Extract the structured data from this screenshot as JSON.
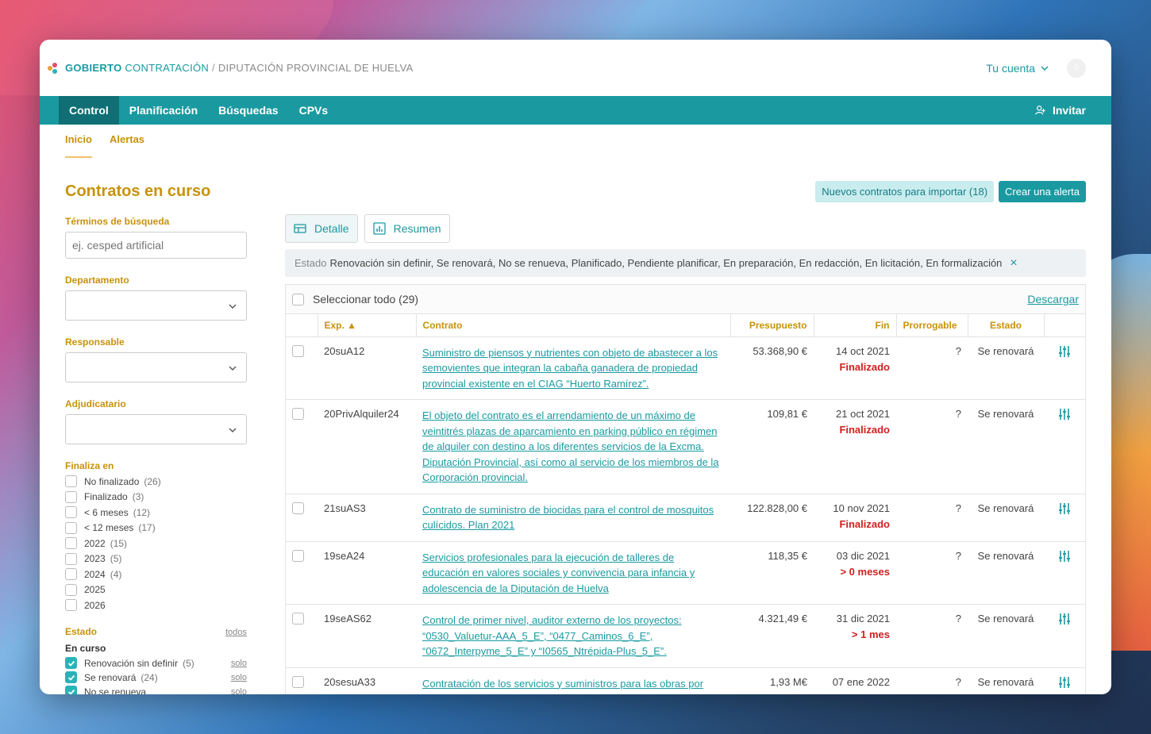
{
  "header": {
    "brand_bold": "GOBIERTO",
    "brand_rest": " CONTRATACIÓN",
    "separator": " / ",
    "organization": "DIPUTACIÓN PROVINCIAL DE HUELVA",
    "account_label": "Tu cuenta",
    "avatar_count": "0"
  },
  "nav": {
    "tabs": [
      "Control",
      "Planificación",
      "Búsquedas",
      "CPVs"
    ],
    "invite_label": "Invitar"
  },
  "subnav": {
    "items": [
      "Inicio",
      "Alertas"
    ]
  },
  "page": {
    "title": "Contratos en curso",
    "import_button": "Nuevos contratos para importar (18)",
    "alert_button": "Crear una alerta"
  },
  "filters": {
    "search_label": "Términos de búsqueda",
    "search_placeholder": "ej. cesped artificial",
    "department_label": "Departamento",
    "responsible_label": "Responsable",
    "awardee_label": "Adjudicatario",
    "ends_label": "Finaliza en",
    "ends_options": [
      {
        "label": "No finalizado",
        "count": "(26)"
      },
      {
        "label": "Finalizado",
        "count": "(3)"
      },
      {
        "label": "< 6 meses",
        "count": "(12)"
      },
      {
        "label": "< 12 meses",
        "count": "(17)"
      },
      {
        "label": "2022",
        "count": "(15)"
      },
      {
        "label": "2023",
        "count": "(5)"
      },
      {
        "label": "2024",
        "count": "(4)"
      },
      {
        "label": "2025",
        "count": ""
      },
      {
        "label": "2026",
        "count": ""
      }
    ],
    "state_label": "Estado",
    "state_all": "todos",
    "state_group": "En curso",
    "state_options": [
      {
        "label": "Renovación sin definir",
        "count": "(5)",
        "only": "solo"
      },
      {
        "label": "Se renovará",
        "count": "(24)",
        "only": "solo"
      },
      {
        "label": "No se renueva",
        "count": "",
        "only": "solo"
      }
    ]
  },
  "main": {
    "view_detail": "Detalle",
    "view_summary": "Resumen",
    "filter_key": "Estado",
    "filter_value": "Renovación sin definir, Se renovará, No se renueva, Planificado, Pendiente planificar, En preparación, En redacción, En licitación, En formalización",
    "filter_close": "×",
    "select_all": "Seleccionar todo (29)",
    "download": "Descargar",
    "columns": {
      "exp": "Exp. ▲",
      "contract": "Contrato",
      "budget": "Presupuesto",
      "end": "Fin",
      "extendable": "Prorrogable",
      "state": "Estado"
    },
    "rows": [
      {
        "exp": "20suA12",
        "contract": "Suministro de piensos y nutrientes con objeto de abastecer a los semovientes que integran la cabaña ganadera de propiedad provincial existente en el CIAG “Huerto Ramírez”.",
        "budget": "53.368,90 €",
        "end": "14 oct 2021",
        "end_status": "Finalizado",
        "extendable": "?",
        "state": "Se renovará"
      },
      {
        "exp": "20PrivAlquiler24",
        "contract": "El objeto del contrato es el arrendamiento de un máximo de veintitrés plazas de aparcamiento en parking público en régimen de alquiler con destino a los diferentes servicios de la Excma. Diputación Provincial, así como al servicio de los miembros de la Corporación provincial.",
        "budget": "109,81 €",
        "end": "21 oct 2021",
        "end_status": "Finalizado",
        "extendable": "?",
        "state": "Se renovará"
      },
      {
        "exp": "21suAS3",
        "contract": "Contrato de suministro de biocidas para el control de mosquitos culícidos. Plan 2021",
        "budget": "122.828,00 €",
        "end": "10 nov 2021",
        "end_status": "Finalizado",
        "extendable": "?",
        "state": "Se renovará"
      },
      {
        "exp": "19seA24",
        "contract": "Servicios profesionales para la ejecución de talleres de educación en valores sociales y convivencia para infancia y adolescencia de la Diputación de Huelva",
        "budget": "118,35 €",
        "end": "03 dic 2021",
        "end_status": "> 0 meses",
        "extendable": "?",
        "state": "Se renovará"
      },
      {
        "exp": "19seAS62",
        "contract": "Control de primer nivel, auditor externo de los proyectos: “0530_Valuetur-AAA_5_E”, “0477_Caminos_6_E”, “0672_Interpyme_5_E” y “I0565_Ntrépida-Plus_5_E”.",
        "budget": "4.321,49 €",
        "end": "31 dic 2021",
        "end_status": "> 1 mes",
        "extendable": "?",
        "state": "Se renovará"
      },
      {
        "exp": "20sesuA33",
        "contract": "Contratación de los servicios y suministros para las obras por",
        "budget": "1,93 M€",
        "end": "07 ene 2022",
        "end_status": "",
        "extendable": "?",
        "state": "Se renovará"
      }
    ]
  }
}
